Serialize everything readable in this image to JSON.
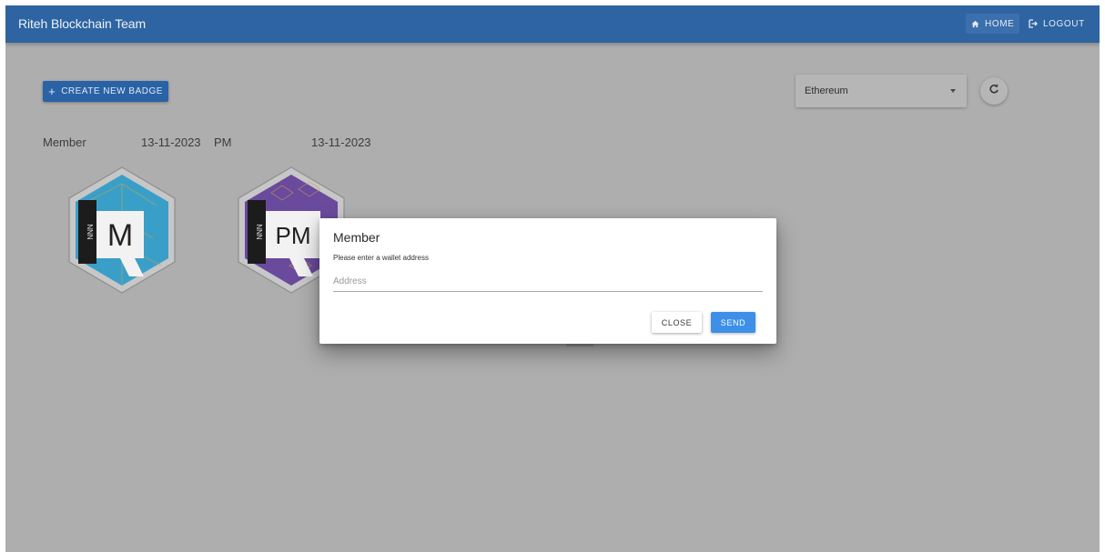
{
  "topbar": {
    "brand": "Riteh Blockchain Team",
    "home_label": "HOME",
    "logout_label": "LOGOUT"
  },
  "toolbar": {
    "create_label": "CREATE NEW BADGE",
    "network_selected": "Ethereum"
  },
  "badges_header": {
    "col1": "Member",
    "col2": "13-11-2023",
    "col3": "PM",
    "col4": "13-11-2023"
  },
  "badges": [
    {
      "letters": "M",
      "side_text": "NNN",
      "color": "#3a9fc8"
    },
    {
      "letters": "PM",
      "side_text": "NNN",
      "color": "#6a4a9c"
    }
  ],
  "dialog": {
    "title": "Member",
    "text": "Please enter a wallet address",
    "address_placeholder": "Address",
    "address_value": "",
    "close_label": "CLOSE",
    "send_label": "SEND"
  },
  "colors": {
    "topbar": "#2e64a2",
    "overlay_bg": "#aeaeae",
    "primary_button": "#2a62a6",
    "send_button": "#3d8fe8"
  },
  "icons": {
    "home": "home-icon",
    "logout": "logout-icon",
    "refresh": "refresh-icon",
    "dropdown": "caret-down-icon"
  }
}
